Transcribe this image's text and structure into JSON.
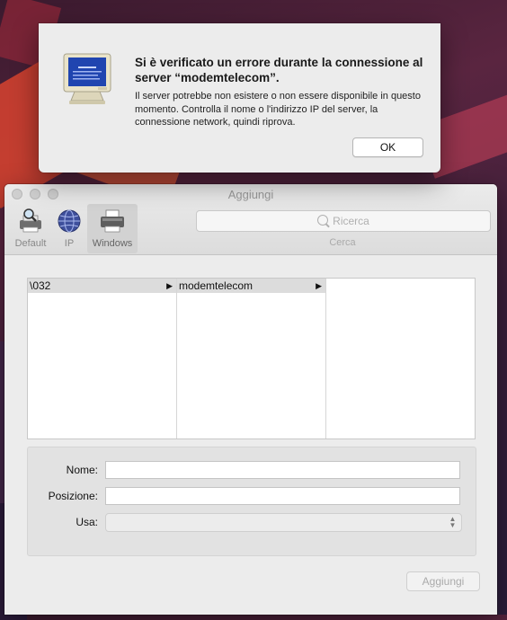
{
  "alert": {
    "title": "Si è verificato un errore durante la connessione al server “modemtelecom”.",
    "message": "Il server potrebbe non esistere o non essere disponibile in questo momento. Controlla il nome o l'indirizzo IP del server, la connessione network, quindi riprova.",
    "ok_label": "OK",
    "icon": "computer-monitor-icon"
  },
  "window": {
    "title": "Aggiungi",
    "toolbar": {
      "items": [
        {
          "label": "Default",
          "icon": "printer-magnifier-icon"
        },
        {
          "label": "IP",
          "icon": "globe-icon"
        },
        {
          "label": "Windows",
          "icon": "windows-printer-icon"
        }
      ],
      "search_placeholder": "Ricerca",
      "search_caption": "Cerca"
    },
    "browser": {
      "col1": [
        {
          "label": "\\032",
          "has_children": true
        }
      ],
      "col2": [
        {
          "label": "modemtelecom",
          "has_children": true
        }
      ]
    },
    "form": {
      "name_label": "Nome:",
      "name_value": "",
      "location_label": "Posizione:",
      "location_value": "",
      "use_label": "Usa:",
      "use_value": ""
    },
    "add_button": "Aggiungi"
  }
}
